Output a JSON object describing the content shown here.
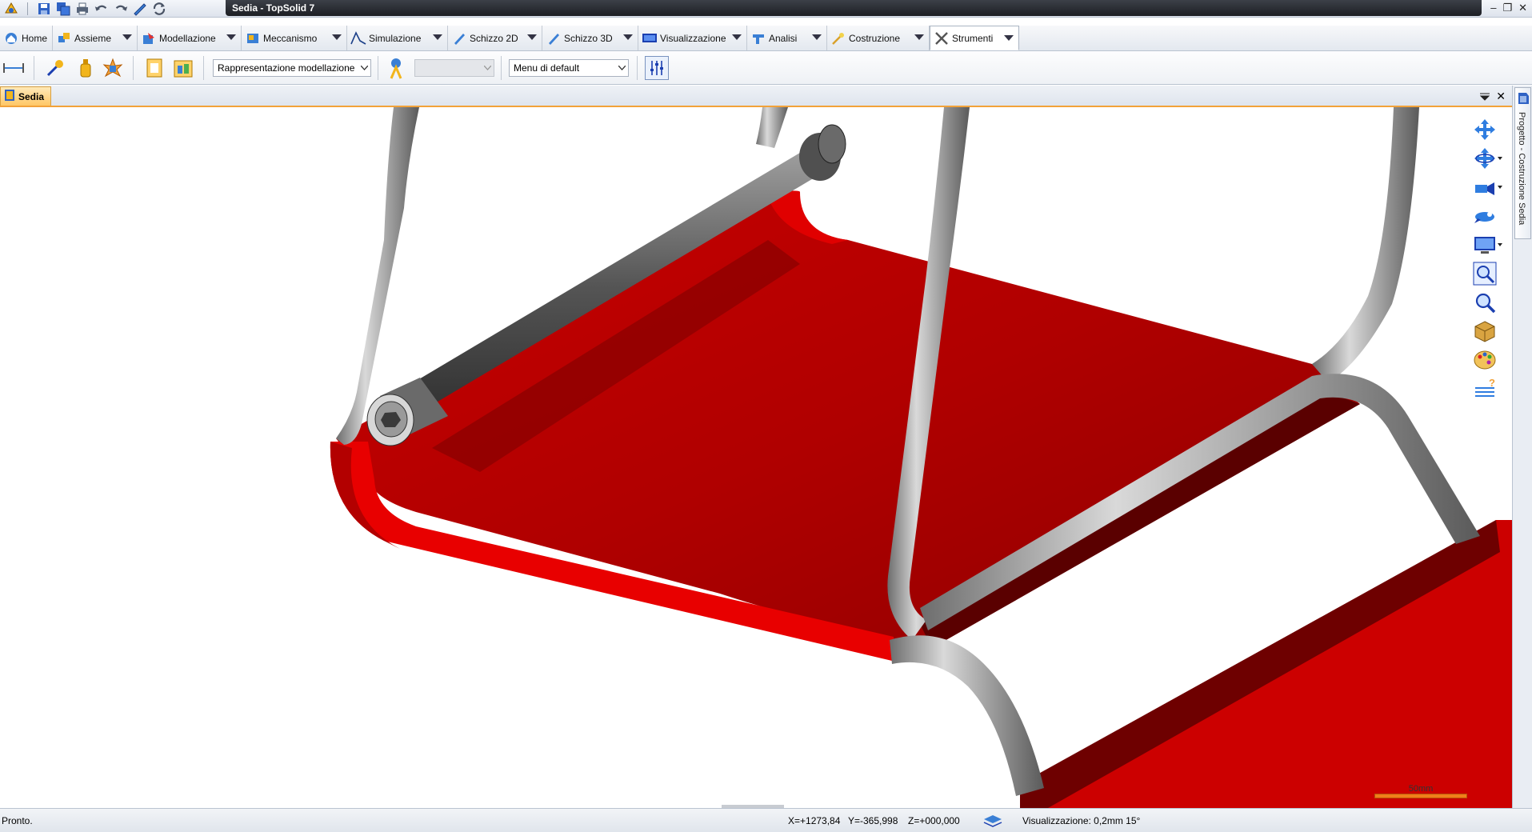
{
  "window": {
    "title": "Sedia - TopSolid 7",
    "controls": [
      "minimize",
      "restore",
      "close"
    ]
  },
  "quick_access": [
    {
      "name": "app-logo-icon"
    },
    {
      "name": "save-icon"
    },
    {
      "name": "save-all-icon"
    },
    {
      "name": "print-icon"
    },
    {
      "name": "undo-icon"
    },
    {
      "name": "redo-icon"
    },
    {
      "name": "pen-icon"
    },
    {
      "name": "refresh-icon"
    }
  ],
  "ribbon": {
    "tabs": [
      {
        "label": "Home",
        "icon": "home-icon",
        "color": "#3a7fd5"
      },
      {
        "label": "Assieme",
        "icon": "assembly-icon",
        "color": "#3a7fd5"
      },
      {
        "label": "Modellazione",
        "icon": "modeling-icon",
        "color": "#3a7fd5"
      },
      {
        "label": "Meccanismo",
        "icon": "mechanism-icon",
        "color": "#3a7fd5"
      },
      {
        "label": "Simulazione",
        "icon": "simulation-icon",
        "color": "#3a7fd5"
      },
      {
        "label": "Schizzo 2D",
        "icon": "sketch-2d-icon",
        "color": "#3a7fd5"
      },
      {
        "label": "Schizzo 3D",
        "icon": "sketch-3d-icon",
        "color": "#3a7fd5"
      },
      {
        "label": "Visualizzazione",
        "icon": "display-icon",
        "color": "#1b3fb0"
      },
      {
        "label": "Analisi",
        "icon": "analysis-icon",
        "color": "#3a7fd5"
      },
      {
        "label": "Costruzione",
        "icon": "construction-icon",
        "color": "#d9a12a"
      },
      {
        "label": "Strumenti",
        "icon": "tools-icon",
        "color": "#666666",
        "active": true
      }
    ]
  },
  "toolbar": {
    "representation_combo": "Rappresentazione modellazione",
    "empty_combo": "",
    "menu_combo": "Menu di default"
  },
  "document": {
    "tab_label": "Sedia"
  },
  "side_panel": {
    "label": "Progetto - Costruzione Sedia"
  },
  "view_tools": [
    {
      "name": "pan-icon"
    },
    {
      "name": "rotate-icon"
    },
    {
      "name": "camera-icon"
    },
    {
      "name": "fly-icon"
    },
    {
      "name": "screen-icon"
    },
    {
      "name": "zoom-window-icon"
    },
    {
      "name": "zoom-icon"
    },
    {
      "name": "cube-icon"
    },
    {
      "name": "palette-icon"
    },
    {
      "name": "help-layers-icon"
    }
  ],
  "scale": {
    "label": "50mm",
    "color": "#f07e1a"
  },
  "status": {
    "ready": "Pronto.",
    "x": "X=+1273,84",
    "y": "Y=-365,998",
    "z": "Z=+000,000",
    "visual": "Visualizzazione: 0,2mm 15°"
  },
  "colors": {
    "seat_red": "#c40000",
    "tube_steel": "#9a9a9a",
    "accent_orange": "#f2a23a"
  }
}
